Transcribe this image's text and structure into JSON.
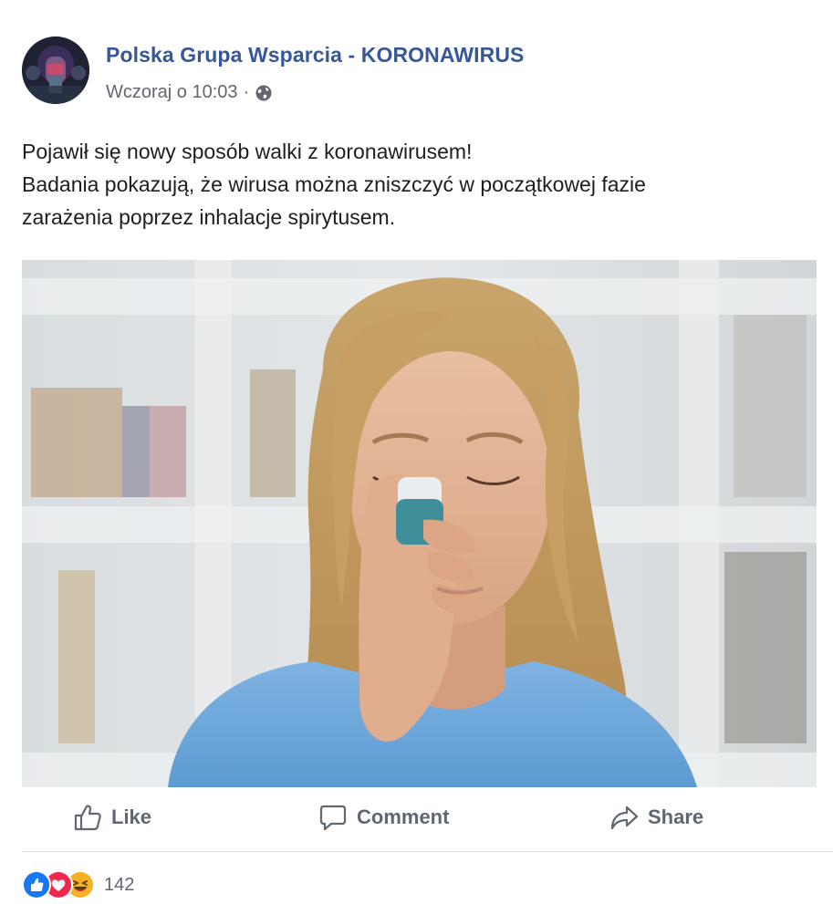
{
  "post": {
    "group_name": "Polska Grupa Wsparcia - KORONAWIRUS",
    "timestamp": "Wczoraj o 10:03",
    "separator": "·",
    "privacy_icon": "globe-icon",
    "text_lines": [
      "Pojawił się nowy sposób walki z koronawirusem!",
      "Badania pokazują, że wirusa można zniszczyć w początkowej fazie",
      "zarażenia poprzez inhalacje spirytusem."
    ]
  },
  "actions": {
    "like": "Like",
    "comment": "Comment",
    "share": "Share"
  },
  "reactions": {
    "types": [
      "like-reaction-icon",
      "love-reaction-icon",
      "haha-reaction-icon"
    ],
    "count": "142"
  },
  "colors": {
    "link": "#365899",
    "meta": "#616770",
    "action": "#606770",
    "like": "#1877f2",
    "love": "#f0284a",
    "haha": "#f7b125"
  }
}
